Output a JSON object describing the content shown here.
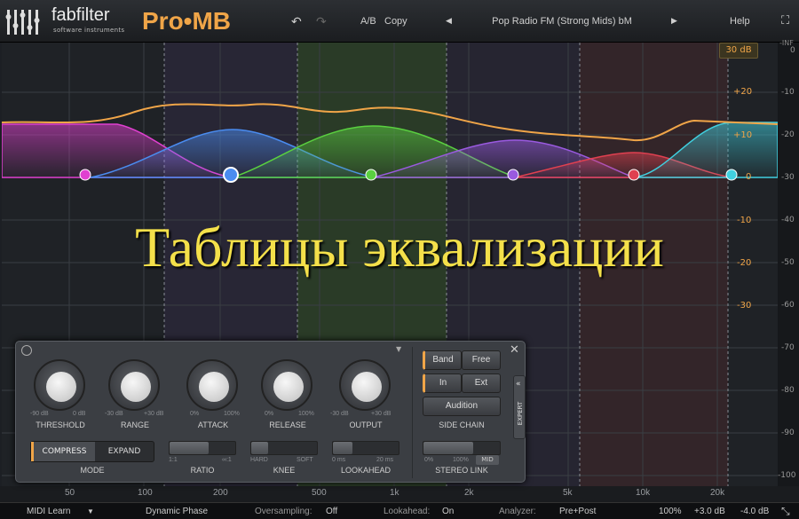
{
  "header": {
    "brand": "fabfilter",
    "brand_sub": "software instruments",
    "product": "Pro•MB",
    "undo_icon": "undo-icon",
    "redo_icon": "redo-icon",
    "ab_label": "A/B",
    "copy_label": "Copy",
    "preset_name": "Pop Radio FM (Strong Mids) bM",
    "help_label": "Help",
    "fullscreen_icon": "fullscreen-icon"
  },
  "overlay_title": "Таблицы эквализации",
  "range_button": "30 dB",
  "gain_scale": [
    "+20",
    "+10",
    "0",
    "-10",
    "-20",
    "-30"
  ],
  "level_scale": [
    "-INF",
    "0",
    "-10",
    "-20",
    "-30",
    "-40",
    "-50",
    "-60",
    "-70",
    "-80",
    "-90",
    "-100"
  ],
  "freq_labels": [
    "50",
    "100",
    "200",
    "500",
    "1k",
    "2k",
    "5k",
    "10k",
    "20k"
  ],
  "band_colors": [
    "#e040d0",
    "#4a8cf0",
    "#5ad040",
    "#9a5ae0",
    "#e04050",
    "#40d0e0"
  ],
  "panel": {
    "knobs": [
      {
        "label": "THRESHOLD",
        "min": "-90 dB",
        "max": "0 dB"
      },
      {
        "label": "RANGE",
        "min": "-30 dB",
        "max": "+30 dB"
      },
      {
        "label": "ATTACK",
        "min": "0%",
        "max": "100%"
      },
      {
        "label": "RELEASE",
        "min": "0%",
        "max": "100%"
      },
      {
        "label": "OUTPUT",
        "min": "-30 dB",
        "max": "+30 dB"
      }
    ],
    "mode_compress": "COMPRESS",
    "mode_expand": "EXPAND",
    "mode_label": "MODE",
    "ratio_label": "RATIO",
    "ratio_min": "1:1",
    "ratio_max": "∞:1",
    "knee_label": "KNEE",
    "knee_min": "HARD",
    "knee_max": "SOFT",
    "lookahead_label": "LOOKAHEAD",
    "lookahead_min": "0 ms",
    "lookahead_max": "20 ms",
    "band_btn": "Band",
    "free_btn": "Free",
    "in_btn": "In",
    "ext_btn": "Ext",
    "audition_btn": "Audition",
    "side_chain_label": "SIDE CHAIN",
    "stereo_min": "0%",
    "stereo_max": "100%",
    "stereo_mid": "MID",
    "stereo_label": "STEREO LINK",
    "expert_label": "EXPERT",
    "close_icon": "close-icon",
    "power_icon": "power-icon"
  },
  "status": {
    "midi_learn": "MIDI Learn",
    "phase": "Dynamic Phase",
    "oversampling_label": "Oversampling:",
    "oversampling_value": "Off",
    "lookahead_label": "Lookahead:",
    "lookahead_value": "On",
    "analyzer_label": "Analyzer:",
    "analyzer_value": "Pre+Post",
    "zoom": "100%",
    "gain1": "+3.0 dB",
    "gain2": "-4.0 dB"
  }
}
